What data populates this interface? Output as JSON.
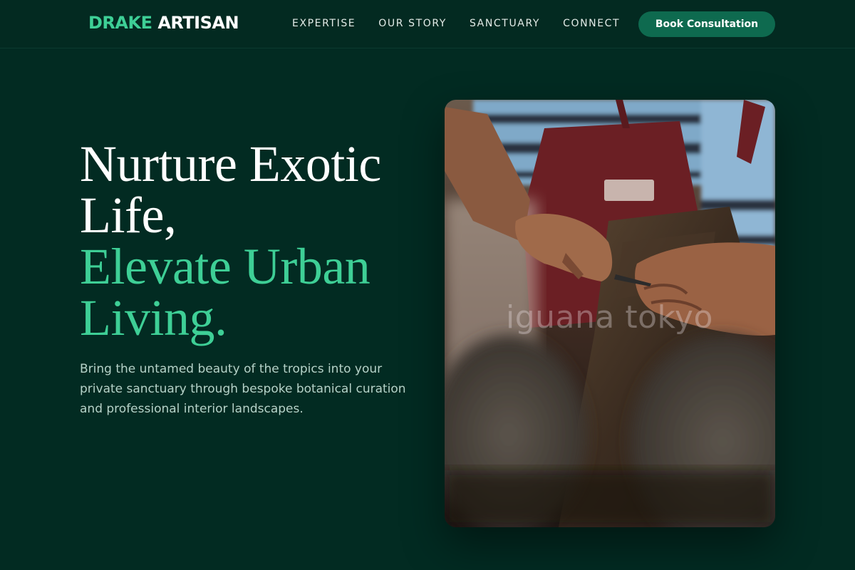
{
  "nav": {
    "brand_part1": "DRAKE",
    "brand_part2": "ARTISAN",
    "links": [
      "EXPERTISE",
      "OUR STORY",
      "SANCTUARY",
      "CONNECT"
    ],
    "cta_label": "Book Consultation"
  },
  "hero": {
    "title_line1": "Nurture Exotic",
    "title_line2": "Life,",
    "title_line3": "Elevate Urban",
    "title_line4": "Living.",
    "subtitle": "Bring the untamed beauty of the tropics into your private sanctuary through bespoke botanical curation and professional interior landscapes.",
    "image_watermark": "iguana tokyo"
  },
  "colors": {
    "background": "#022b22",
    "accent": "#3ecf96",
    "cta": "#0e6a4f"
  }
}
